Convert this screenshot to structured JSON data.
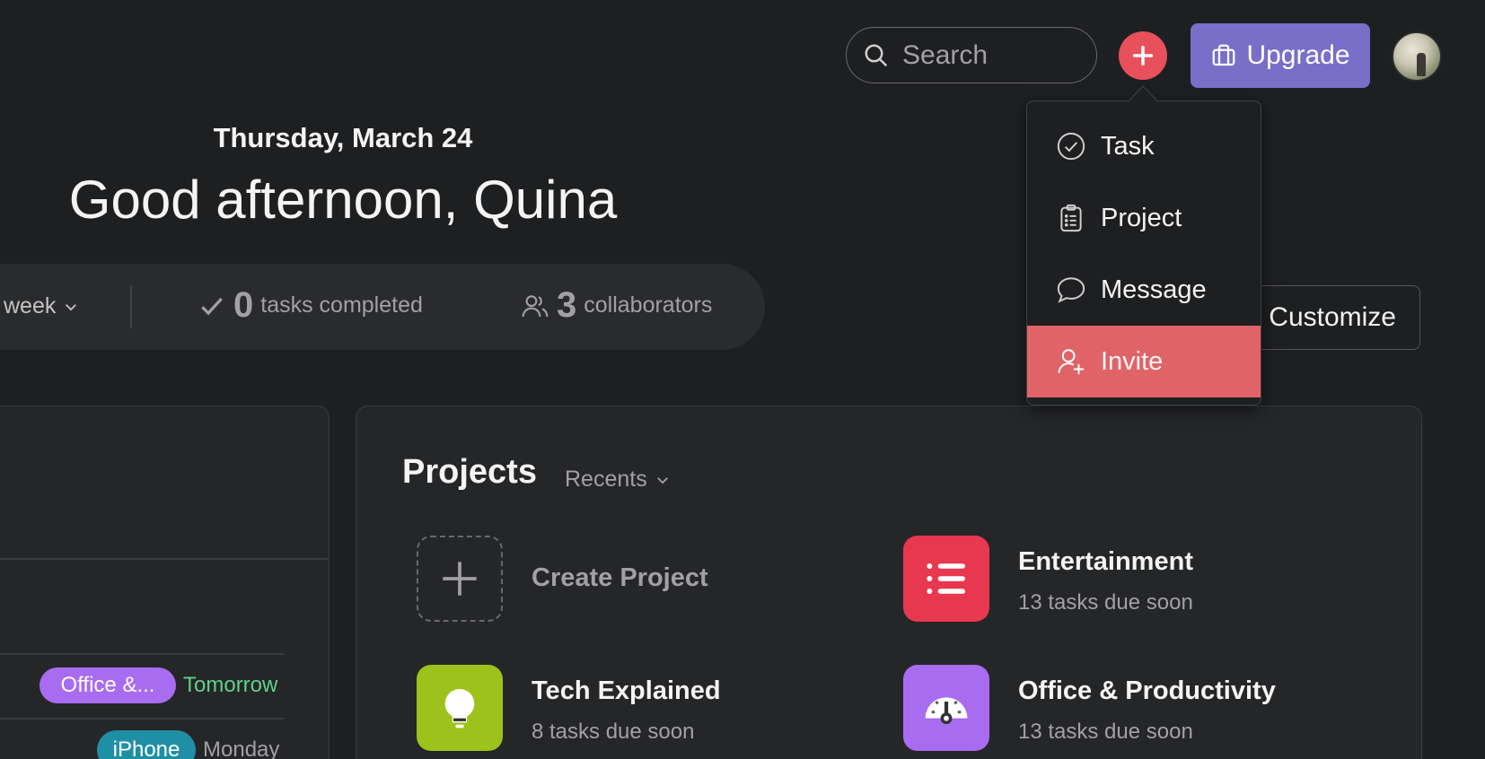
{
  "header": {
    "search_placeholder": "Search",
    "upgrade_label": "Upgrade"
  },
  "greeting": {
    "date": "Thursday, March 24",
    "text": "Good afternoon, Quina"
  },
  "stats": {
    "period_label": "week",
    "tasks_completed_count": "0",
    "tasks_completed_label": "tasks completed",
    "collaborators_count": "3",
    "collaborators_label": "collaborators"
  },
  "customize_label": "Customize",
  "create_menu": {
    "items": [
      {
        "label": "Task",
        "icon": "check-circle-icon"
      },
      {
        "label": "Project",
        "icon": "clipboard-list-icon"
      },
      {
        "label": "Message",
        "icon": "speech-bubble-icon"
      },
      {
        "label": "Invite",
        "icon": "add-person-icon",
        "highlighted": true
      }
    ]
  },
  "tasks_card": {
    "rows": [
      {
        "tag": "Office &...",
        "tag_color": "#a86cf0",
        "due": "Tomorrow",
        "due_color": "#5fd08a"
      },
      {
        "tag": "iPhone",
        "tag_color": "#1f8fa6",
        "due": "Monday",
        "due_color": "#a2a0a2"
      }
    ]
  },
  "projects": {
    "title": "Projects",
    "filter_label": "Recents",
    "create_label": "Create Project",
    "items": [
      {
        "name": "Entertainment",
        "subtitle": "13 tasks due soon",
        "color": "#e8384f",
        "icon": "list-icon"
      },
      {
        "name": "Tech Explained",
        "subtitle": "8 tasks due soon",
        "color": "#9cc21b",
        "icon": "lightbulb-icon"
      },
      {
        "name": "Office & Productivity",
        "subtitle": "13 tasks due soon",
        "color": "#a86cf0",
        "icon": "gauge-icon"
      }
    ]
  },
  "colors": {
    "background": "#1e1f21",
    "accent_add": "#e8505b",
    "upgrade": "#7a6ec9",
    "invite_highlight": "#e06368"
  }
}
